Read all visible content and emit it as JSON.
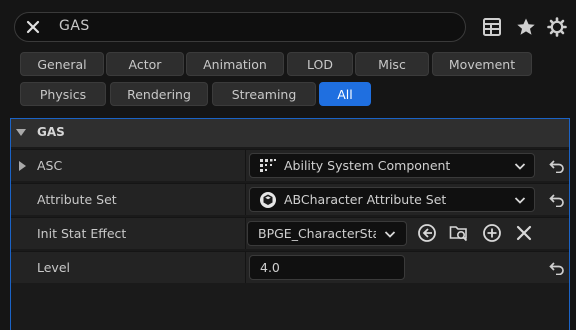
{
  "search": {
    "value": "GAS"
  },
  "toolbar": {
    "icons": [
      "table-view-icon",
      "star-icon",
      "gear-icon"
    ]
  },
  "filters": [
    {
      "label": "General",
      "active": false
    },
    {
      "label": "Actor",
      "active": false
    },
    {
      "label": "Animation",
      "active": false
    },
    {
      "label": "LOD",
      "active": false
    },
    {
      "label": "Misc",
      "active": false
    },
    {
      "label": "Movement",
      "active": false
    },
    {
      "label": "Physics",
      "active": false
    },
    {
      "label": "Rendering",
      "active": false
    },
    {
      "label": "Streaming",
      "active": false
    },
    {
      "label": "All",
      "active": true
    }
  ],
  "category": {
    "title": "GAS"
  },
  "properties": {
    "asc": {
      "label": "ASC",
      "value": "Ability System Component"
    },
    "attribute_set": {
      "label": "Attribute Set",
      "value": "ABCharacter Attribute Set"
    },
    "init_stat_effect": {
      "label": "Init Stat Effect",
      "value": "BPGE_CharacterStat"
    },
    "level": {
      "label": "Level",
      "value": "4.0"
    }
  },
  "colors": {
    "accent": "#1f6fe0",
    "panel_border": "#1b63c6"
  }
}
